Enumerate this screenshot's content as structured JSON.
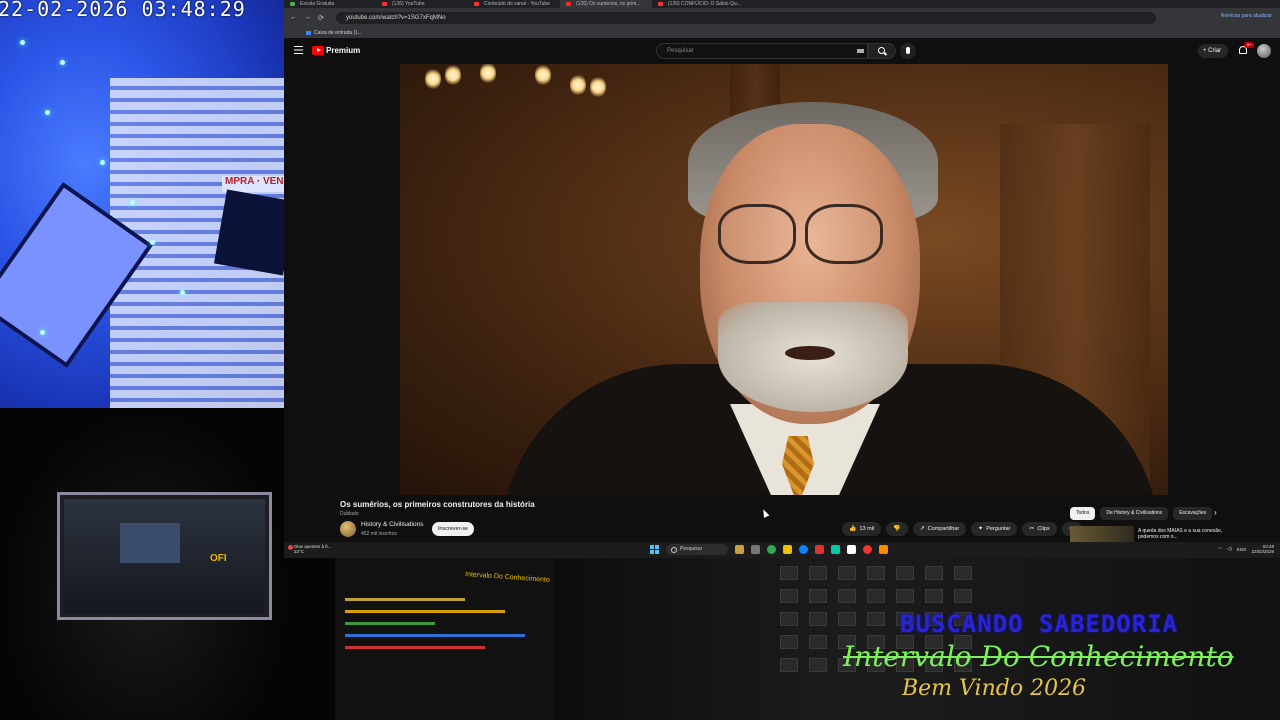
{
  "camera": {
    "timestamp": "22-02-2026  03:48:29",
    "sign_text": "MPRA · VEN"
  },
  "browser": {
    "tabs": [
      {
        "label": "Escola Gratuita"
      },
      {
        "label": "(126) YouTube"
      },
      {
        "label": "Conteúdo do canal - YouTube"
      },
      {
        "label": "(126) Os sumérios, os prim..."
      },
      {
        "label": "(126) CONFÚCIO: O Sábio Qu..."
      }
    ],
    "url": "youtube.com/watch?v=1SG7xFqMNo",
    "relaunch_label": "Reiniciar para atualizar",
    "bookmark": "Caixa de entrada (1..."
  },
  "youtube": {
    "brand": "Premium",
    "search_placeholder": "Pesquisar",
    "create_label": "+ Criar",
    "notif_count": "9+",
    "video": {
      "title": "Os sumérios, os primeiros construtores da história",
      "subtitle": "Dublado",
      "channel": "History & Civilisations",
      "subscribers": "452 mil inscritos",
      "subscribe_label": "Inscrever-se"
    },
    "actions": [
      {
        "icon": "like-icon",
        "glyph": "👍",
        "label": "13 mil"
      },
      {
        "icon": "dislike-icon",
        "glyph": "👎",
        "label": ""
      },
      {
        "icon": "share-icon",
        "glyph": "↗",
        "label": "Compartilhar"
      },
      {
        "icon": "ask-icon",
        "glyph": "✦",
        "label": "Perguntar"
      },
      {
        "icon": "clip-icon",
        "glyph": "✂",
        "label": "Clips"
      },
      {
        "icon": "more-icon",
        "glyph": "⋯",
        "label": ""
      }
    ],
    "chips": [
      "Todos",
      "De History & Civilisations",
      "Escavações"
    ],
    "recommended_title": "A queda dos MAIAS e a sua conexão, podemos com o..."
  },
  "taskbar": {
    "weather_line1": "Dias quentes à fr...",
    "weather_line2": "23°C",
    "search_label": "Pesquisar",
    "lang": "ENG",
    "time": "03:48",
    "date": "22/02/2026"
  },
  "mixer_title": "Intervalo Do Conhecimento",
  "overlays": {
    "line1": "BUSCANDO SABEDORIA",
    "line2": "Intervalo Do Conhecimento",
    "line3": "Bem Vindo 2026"
  },
  "colors": {
    "accent_red": "#ff0000",
    "overlay_green": "#7cf25a",
    "overlay_gold": "#e4c54a",
    "overlay_blue": "#2a24d8"
  }
}
